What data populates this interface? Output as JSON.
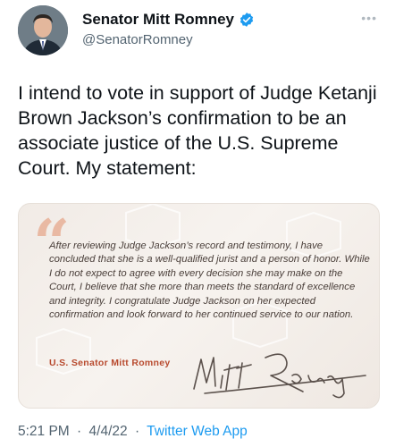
{
  "author": {
    "display_name": "Senator Mitt Romney",
    "handle": "@SenatorRomney",
    "verified": true,
    "verified_color": "#1d9bf0"
  },
  "more_menu": {
    "icon": "more-icon"
  },
  "tweet": {
    "text": "I intend to vote in support of Judge Ketanji Brown Jackson’s confirmation to be an associate justice of the U.S. Supreme Court. My statement:"
  },
  "card": {
    "statement": "After reviewing Judge Jackson’s record and testimony, I have concluded that she is a well-qualified jurist and a person of honor. While I do not expect to agree with every decision she may make on the Court, I believe that she more than meets the standard of excellence and integrity. I congratulate Judge Jackson on her expected confirmation and look forward to her continued service to our nation.",
    "signer": "U.S. Senator Mitt Romney",
    "signature_text": "Mitt Romney",
    "accent_color": "#b84a2e"
  },
  "meta": {
    "time": "5:21 PM",
    "date": "4/4/22",
    "separator": "·",
    "source": "Twitter Web App"
  }
}
